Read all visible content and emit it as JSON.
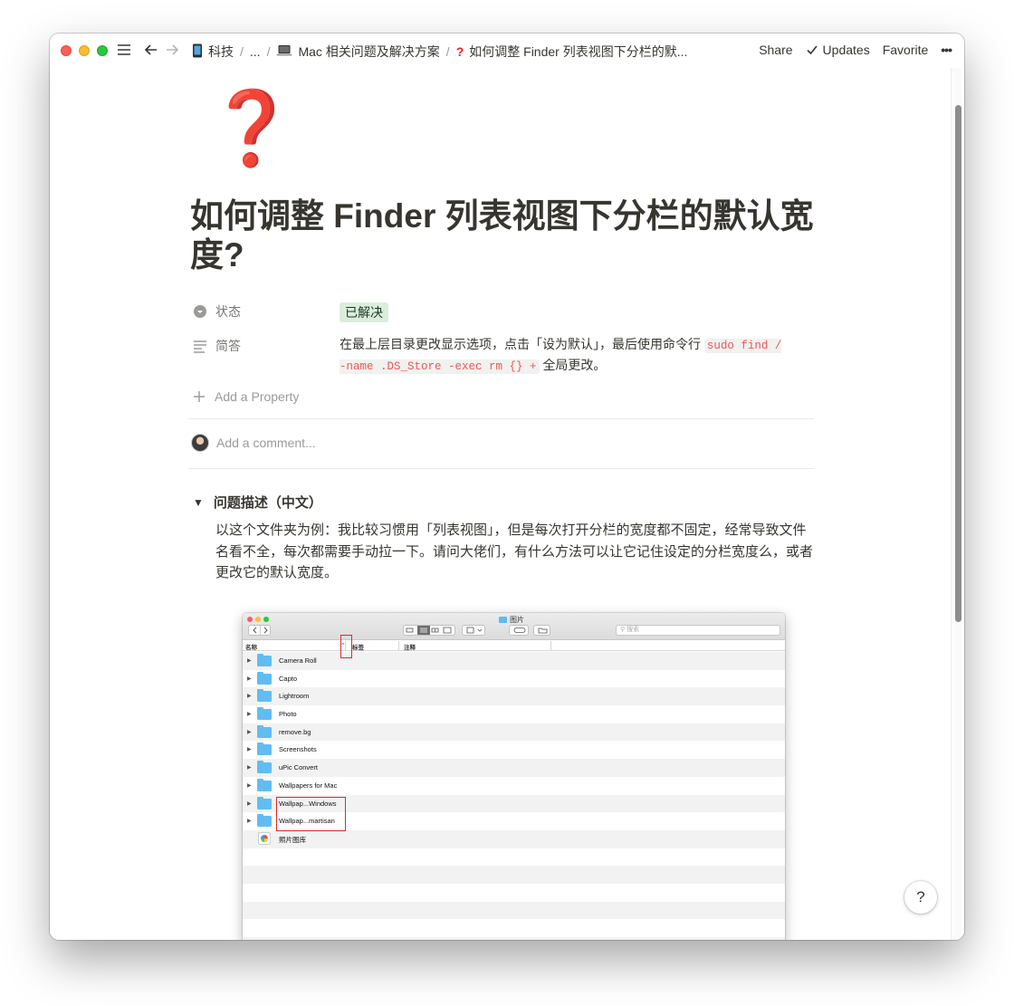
{
  "topbar": {
    "breadcrumbs": [
      {
        "icon": "mobile-phone-icon",
        "label": "科技"
      },
      {
        "icon": "",
        "label": "..."
      },
      {
        "icon": "laptop-icon",
        "label": "Mac 相关问题及解决方案"
      },
      {
        "icon": "question-mark-icon",
        "label": "如何调整 Finder 列表视图下分栏的默..."
      }
    ],
    "share": "Share",
    "updates": "Updates",
    "favorite": "Favorite",
    "more": "•••"
  },
  "page": {
    "icon": "❓",
    "title": "如何调整 Finder 列表视图下分栏的默认宽度?",
    "properties": {
      "status_label": "状态",
      "status_value": "已解决",
      "status_color": "#dbeddb",
      "answer_label": "简答",
      "answer_text_1": "在最上层目录更改显示选项，点击「设为默认」，最后使用命令行",
      "answer_code": "sudo find / -name .DS_Store -exec rm {} +",
      "answer_text_2": "全局更改。"
    },
    "add_property": "Add a Property",
    "comment_placeholder": "Add a comment...",
    "toggle_heading": "问题描述（中文）",
    "description": "以这个文件夹为例：我比较习惯用「列表视图」，但是每次打开分栏的宽度都不固定，经常导致文件名看不全，每次都需要手动拉一下。请问大佬们，有什么方法可以让它记住设定的分栏宽度么，或者更改它的默认宽度。"
  },
  "finder": {
    "window_title": "图片",
    "search_placeholder": "搜索",
    "columns": [
      "名称",
      "标签",
      "注释"
    ],
    "rows": [
      {
        "name": "Camera Roll",
        "type": "folder"
      },
      {
        "name": "Capto",
        "type": "folder"
      },
      {
        "name": "Lightroom",
        "type": "folder"
      },
      {
        "name": "Photo",
        "type": "folder"
      },
      {
        "name": "remove.bg",
        "type": "folder"
      },
      {
        "name": "Screenshots",
        "type": "folder"
      },
      {
        "name": "uPic Convert",
        "type": "folder"
      },
      {
        "name": "Wallpapers for Mac",
        "type": "folder"
      },
      {
        "name": "Wallpap...Windows",
        "type": "folder"
      },
      {
        "name": "Wallpap...martisan",
        "type": "folder"
      },
      {
        "name": "照片图库",
        "type": "photos-library"
      }
    ]
  },
  "help": "?"
}
